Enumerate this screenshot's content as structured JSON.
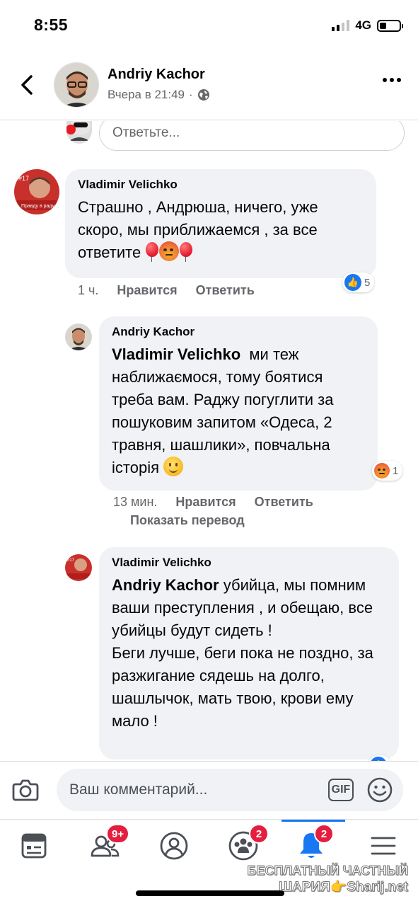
{
  "status_bar": {
    "time": "8:55",
    "network": "4G"
  },
  "header": {
    "name": "Andriy Kachor",
    "timestamp": "Вчера в 21:49",
    "separator": "·"
  },
  "reply_box": {
    "placeholder": "Ответьте..."
  },
  "comments": [
    {
      "author": "Vladimir Velichko",
      "text": "Страшно , Андрюша, ничего, уже скоро, мы приближаемся , за все ответите",
      "time": "1 ч.",
      "like_label": "Нравится",
      "reply_label": "Ответить",
      "reaction_count": "5"
    },
    {
      "author": "Andriy Kachor",
      "mention": "Vladimir Velichko",
      "text": "ми теж наближаємося, тому боятися треба вам. Раджу погуглити за пошуковим запитом «Одеса, 2 травня, шашлики», повчальна історія",
      "time": "13 мин.",
      "like_label": "Нравится",
      "reply_label": "Ответить",
      "translate_label": "Показать перевод",
      "reaction_count": "1"
    },
    {
      "author": "Vladimir Velichko",
      "mention": "Andriy Kachor",
      "text": "убийца, мы помним ваши преступления , и обещаю, все убийцы будут сидеть !",
      "text2": "Беги лучше, беги пока не поздно, за разжигание сядешь на долго, шашлычок, мать твою, крови ему мало !"
    }
  ],
  "composer": {
    "placeholder": "Ваш комментарий...",
    "gif_label": "GIF"
  },
  "tabbar": {
    "badges": {
      "friends": "9+",
      "groups": "2",
      "notifications": "2"
    }
  },
  "watermark": {
    "line1": "БЕСПЛАТНЫЙ ЧАСТНЫЙ",
    "line2": "ШАРИЯ👉Sharij.net"
  },
  "colors": {
    "accent": "#1877f2",
    "bubble": "#f0f2f5",
    "badge": "#e41e3f",
    "secondary_text": "#65676b"
  }
}
